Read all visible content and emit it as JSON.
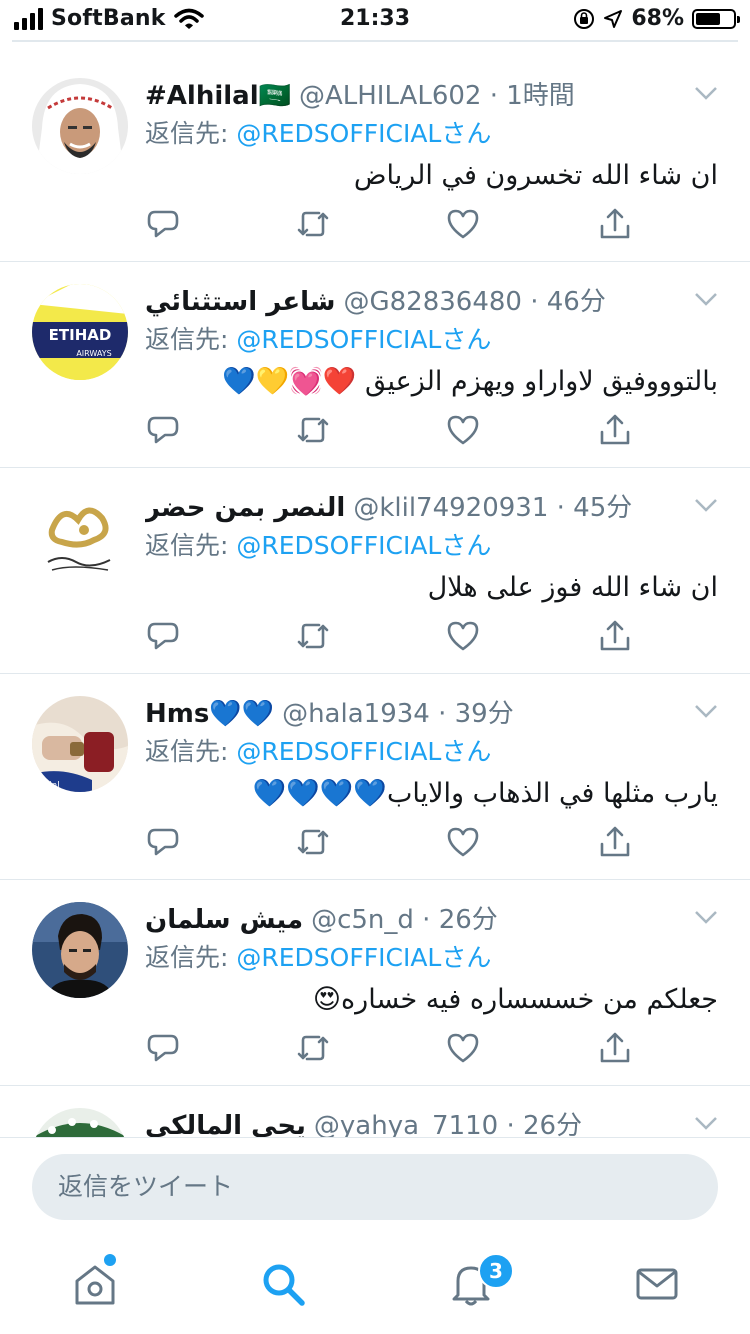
{
  "status_bar": {
    "carrier": "SoftBank",
    "time": "21:33",
    "battery": "68%",
    "battery_level": 0.68
  },
  "reply_prefix": "返信先:",
  "tweets": [
    {
      "name": "#Alhilal🇸🇦",
      "meta": "@ALHILAL602 · 1時間",
      "reply_handle": "@REDSOFFICIALさん",
      "text": "ان شاء الله تخسرون في الرياض",
      "avatar": "man-with-ghutra"
    },
    {
      "name": "شاعر استثنائي",
      "meta": "@G82836480 · 46分",
      "reply_handle": "@REDSOFFICIALさん",
      "text": "بالتوووفيق لاواراو ويهزم الزعيق ❤️💓💛💙",
      "avatar": "etihad-jersey"
    },
    {
      "name": "النصر بمن حضر",
      "meta": "@klil74920931 · 45分",
      "reply_handle": "@REDSOFFICIALさん",
      "text": "ان شاء الله فوز على هلال",
      "avatar": "gold-calligraphy"
    },
    {
      "name": "Hms💙💙",
      "meta": "@hala1934 · 39分",
      "reply_handle": "@REDSOFFICIALさん",
      "text": "يارب مثلها في الذهاب والاياب💙💙💙💙",
      "avatar": "hands-with-bracelet"
    },
    {
      "name": "ميش سلمان",
      "meta": "@c5n_d · 26分",
      "reply_handle": "@REDSOFFICIALさん",
      "text": "جعلكم من خسسساره فيه خساره😍",
      "avatar": "young-man-portrait"
    },
    {
      "name": "يحي المالكي",
      "meta": "@yahya_7110 · 26分",
      "reply_handle": "",
      "text": "",
      "avatar": "crowd-banner"
    }
  ],
  "compose": {
    "placeholder": "返信をツイート"
  },
  "tabbar": {
    "notifications_badge": "3",
    "icons": [
      "home-icon",
      "search-icon",
      "notifications-icon",
      "messages-icon"
    ]
  },
  "colors": {
    "accent": "#1da1f2",
    "secondary_text": "#657786",
    "divider": "#e1e8ed"
  }
}
